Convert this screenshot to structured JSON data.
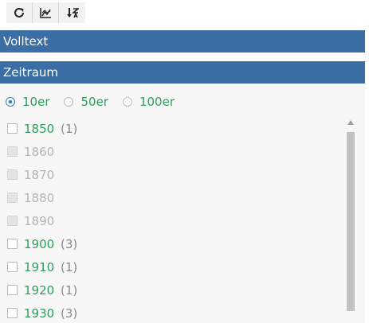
{
  "toolbar": {
    "buttons": [
      {
        "icon": "refresh-icon"
      },
      {
        "icon": "chart-icon"
      },
      {
        "icon": "sort-desc-icon"
      }
    ]
  },
  "sections": {
    "volltext": "Volltext",
    "zeitraum": "Zeitraum"
  },
  "zeitraum": {
    "options": [
      {
        "label": "10er",
        "selected": true
      },
      {
        "label": "50er",
        "selected": false
      },
      {
        "label": "100er",
        "selected": false
      }
    ],
    "items": [
      {
        "year": "1850",
        "count": "(1)",
        "enabled": true
      },
      {
        "year": "1860",
        "count": "",
        "enabled": false
      },
      {
        "year": "1870",
        "count": "",
        "enabled": false
      },
      {
        "year": "1880",
        "count": "",
        "enabled": false
      },
      {
        "year": "1890",
        "count": "",
        "enabled": false
      },
      {
        "year": "1900",
        "count": "(3)",
        "enabled": true
      },
      {
        "year": "1910",
        "count": "(1)",
        "enabled": true
      },
      {
        "year": "1920",
        "count": "(1)",
        "enabled": true
      },
      {
        "year": "1930",
        "count": "(3)",
        "enabled": true
      }
    ]
  },
  "colors": {
    "header": "#3a6ea5",
    "link_green": "#2e9e5b",
    "radio_blue": "#3a7ec8"
  }
}
